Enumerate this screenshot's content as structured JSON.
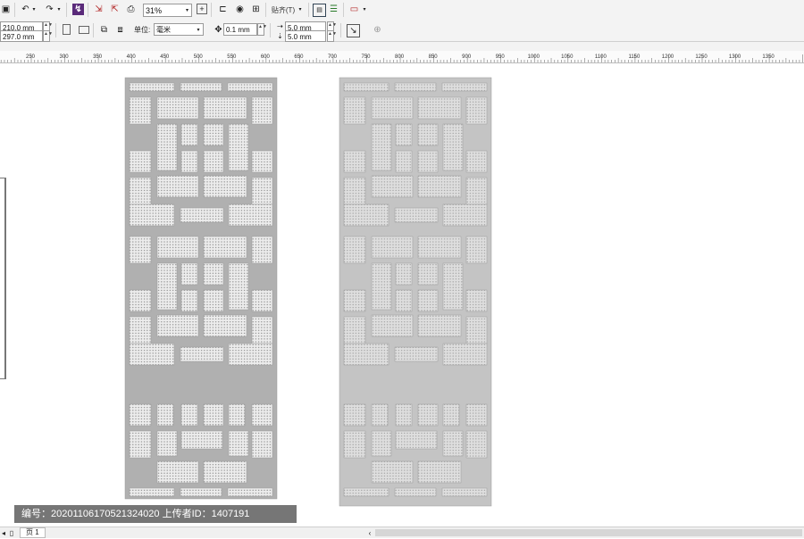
{
  "toolbar": {
    "zoom_value": "31%",
    "snap_label": "贴齐(T)"
  },
  "property_bar": {
    "width_value": "210.0 mm",
    "height_value": "297.0 mm",
    "unit_label": "单位:",
    "unit_value": "毫米",
    "nudge_value": "0.1 mm",
    "dup_x_value": "5.0 mm",
    "dup_y_value": "5.0 mm"
  },
  "ruler": {
    "ticks": [
      "250",
      "300",
      "350",
      "400",
      "450",
      "500",
      "550",
      "600",
      "650",
      "700",
      "750",
      "800",
      "850",
      "900",
      "950",
      "1000",
      "1050",
      "1100",
      "1150",
      "1200",
      "1250",
      "1300",
      "1350"
    ]
  },
  "status_bar": {
    "page_label": "页 1"
  },
  "watermark": {
    "text": "编号：20201106170521324020 上传者ID：1407191"
  },
  "colors": {
    "frame": "#b0b0b0",
    "panel_left": "#e9e9e9",
    "panel_right": "#dcdcdc",
    "dot": "#8a8a8a"
  },
  "icons": [
    "undo-icon",
    "redo-icon",
    "import-icon",
    "export-icon",
    "print-icon",
    "zoom-icon",
    "page-icon",
    "snap-icon",
    "options-icon"
  ]
}
